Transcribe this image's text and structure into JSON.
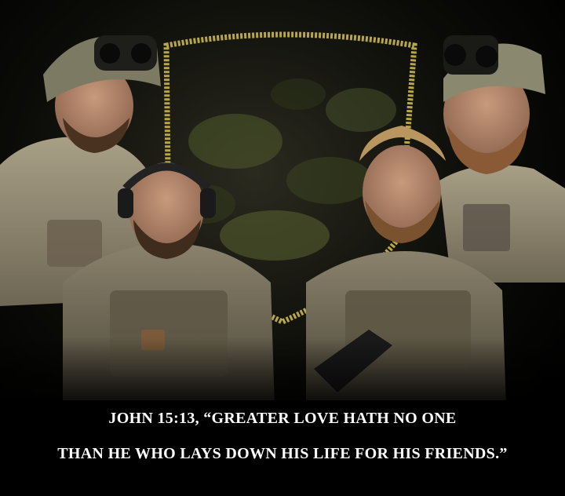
{
  "caption": {
    "line1": "JOHN 15:13, “GREATER LOVE HATH NO ONE",
    "line2": "THAN HE WHO LAYS DOWN HIS LIFE FOR HIS FRIENDS.”"
  },
  "colors": {
    "background": "#000000",
    "caption_text": "#ffffff",
    "shield_rope": "#b8a64a",
    "camo_uniform": "#9a9077",
    "skin": "#b58a6e",
    "beard": "#6b4a2e",
    "helmet": "#7d7a63"
  }
}
